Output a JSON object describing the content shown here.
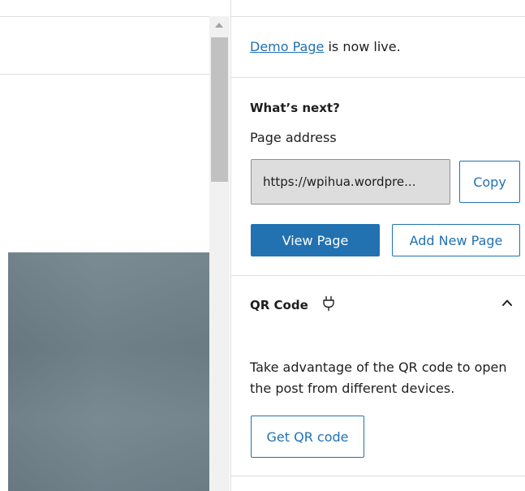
{
  "status": {
    "page_link": "Demo Page",
    "live_suffix": " is now live."
  },
  "next": {
    "heading": "What’s next?",
    "address_label": "Page address",
    "url_value": "https://wpihua.wordpre...",
    "copy_label": "Copy",
    "view_label": "View Page",
    "add_new_label": "Add New Page"
  },
  "qr": {
    "title": "QR Code",
    "description": "Take advantage of the QR code to open the post from different devices.",
    "button_label": "Get QR code",
    "expanded": true,
    "icons": [
      "plug-icon",
      "chevron-up-icon"
    ]
  },
  "colors": {
    "accent": "#2271b1",
    "image_tone": "#6f8089",
    "field_bg": "#dddddd"
  }
}
